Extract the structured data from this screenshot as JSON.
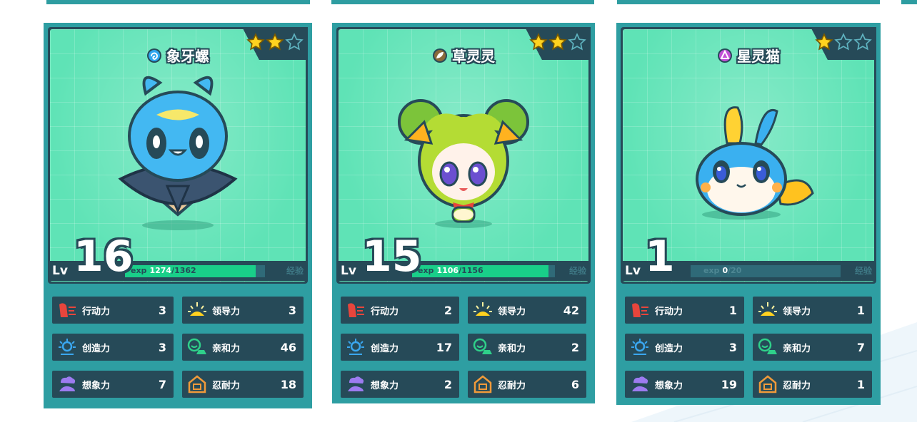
{
  "cards": [
    {
      "name": "象牙螺",
      "element_icon": "water-element-icon",
      "stars": 2,
      "level": "16",
      "level_label": "Lv",
      "exp_label": "exp",
      "exp_current": "1274",
      "exp_max": "/1362",
      "exp_progress": 0.935,
      "exp_side_label": "经验",
      "stats": [
        {
          "label": "行动力",
          "value": "3",
          "icon": "action-power-icon"
        },
        {
          "label": "领导力",
          "value": "3",
          "icon": "leadership-icon"
        },
        {
          "label": "创造力",
          "value": "3",
          "icon": "creativity-icon"
        },
        {
          "label": "亲和力",
          "value": "46",
          "icon": "affinity-icon"
        },
        {
          "label": "想象力",
          "value": "7",
          "icon": "imagination-icon"
        },
        {
          "label": "忍耐力",
          "value": "18",
          "icon": "endurance-icon"
        }
      ]
    },
    {
      "name": "草灵灵",
      "element_icon": "grass-element-icon",
      "stars": 2,
      "level": "15",
      "level_label": "Lv",
      "exp_label": "exp",
      "exp_current": "1106",
      "exp_max": "/1156",
      "exp_progress": 0.957,
      "exp_side_label": "经验",
      "stats": [
        {
          "label": "行动力",
          "value": "2",
          "icon": "action-power-icon"
        },
        {
          "label": "领导力",
          "value": "42",
          "icon": "leadership-icon"
        },
        {
          "label": "创造力",
          "value": "17",
          "icon": "creativity-icon"
        },
        {
          "label": "亲和力",
          "value": "2",
          "icon": "affinity-icon"
        },
        {
          "label": "想象力",
          "value": "2",
          "icon": "imagination-icon"
        },
        {
          "label": "忍耐力",
          "value": "6",
          "icon": "endurance-icon"
        }
      ]
    },
    {
      "name": "星灵猫",
      "element_icon": "star-element-icon",
      "stars": 1,
      "level": "1",
      "level_label": "Lv",
      "exp_label": "exp",
      "exp_current": "0",
      "exp_max": "/20",
      "exp_progress": 0,
      "exp_side_label": "经验",
      "stats": [
        {
          "label": "行动力",
          "value": "1",
          "icon": "action-power-icon"
        },
        {
          "label": "领导力",
          "value": "1",
          "icon": "leadership-icon"
        },
        {
          "label": "创造力",
          "value": "3",
          "icon": "creativity-icon"
        },
        {
          "label": "亲和力",
          "value": "7",
          "icon": "affinity-icon"
        },
        {
          "label": "想象力",
          "value": "19",
          "icon": "imagination-icon"
        },
        {
          "label": "忍耐力",
          "value": "1",
          "icon": "endurance-icon"
        }
      ]
    }
  ],
  "max_stars": 3,
  "colors": {
    "card_frame": "#2e9ea2",
    "panel_dark": "#264a58",
    "art_bg": "#5fe3b6",
    "exp_fill": "#19cf89",
    "star_gold": "#ffd21f"
  }
}
